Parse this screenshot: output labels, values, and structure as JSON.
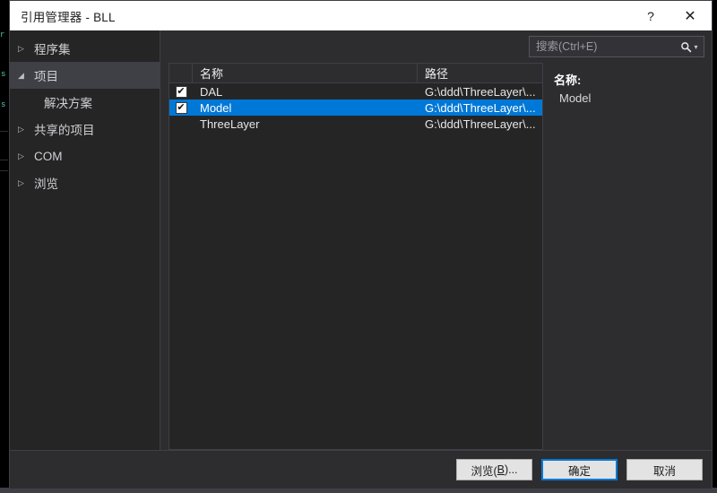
{
  "window": {
    "title": "引用管理器 - BLL",
    "help_icon": "help-icon",
    "help_glyph": "?",
    "close_icon": "close-icon",
    "close_glyph": "✕"
  },
  "sidebar": {
    "items": [
      {
        "label": "程序集",
        "state": "collapsed",
        "level": 0,
        "glyph": "▷"
      },
      {
        "label": "项目",
        "state": "expanded",
        "level": 0,
        "glyph": "◢",
        "selected": true
      },
      {
        "label": "解决方案",
        "state": "leaf",
        "level": 1,
        "glyph": ""
      },
      {
        "label": "共享的项目",
        "state": "collapsed",
        "level": 0,
        "glyph": "▷"
      },
      {
        "label": "COM",
        "state": "collapsed",
        "level": 0,
        "glyph": "▷"
      },
      {
        "label": "浏览",
        "state": "collapsed",
        "level": 0,
        "glyph": "▷"
      }
    ]
  },
  "search": {
    "placeholder": "搜索(Ctrl+E)",
    "value": "",
    "icon": "magnifier-icon",
    "icon_glyph": "⚲",
    "dropdown_icon": "chevron-down-icon",
    "dropdown_glyph": "▾"
  },
  "list": {
    "columns": [
      "",
      "名称",
      "路径"
    ],
    "rows": [
      {
        "checked": true,
        "check_glyph": "✔",
        "name": "DAL",
        "path": "G:\\ddd\\ThreeLayer\\...",
        "selected": false
      },
      {
        "checked": true,
        "check_glyph": "✔",
        "name": "Model",
        "path": "G:\\ddd\\ThreeLayer\\...",
        "selected": true
      },
      {
        "checked": false,
        "check_glyph": "",
        "name": "ThreeLayer",
        "path": "G:\\ddd\\ThreeLayer\\...",
        "selected": false
      }
    ]
  },
  "detail": {
    "label": "名称:",
    "value": "Model"
  },
  "footer": {
    "browse": {
      "pre": "浏览(",
      "accel": "B",
      "post": ")..."
    },
    "ok": "确定",
    "cancel": "取消"
  },
  "colors": {
    "accent": "#0078d7",
    "dialog_bg": "#2d2d30",
    "panel_bg": "#252526",
    "titlebar_bg": "#ffffff",
    "border": "#3f3f46"
  },
  "backdrop": {
    "fragments": [
      "r",
      "s",
      "s"
    ]
  }
}
